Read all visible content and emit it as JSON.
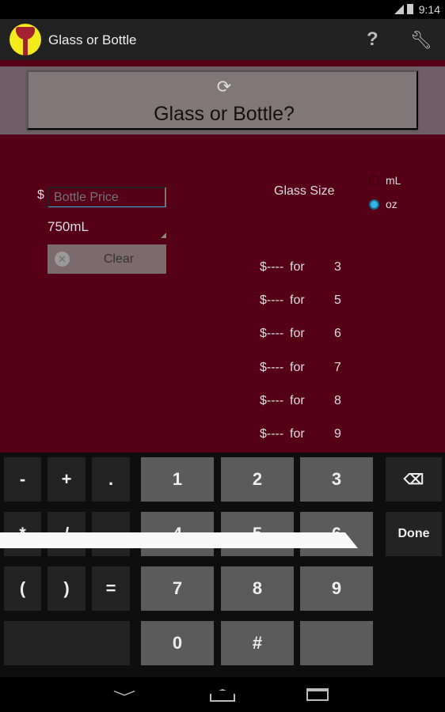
{
  "status": {
    "time": "9:14"
  },
  "actionbar": {
    "title": "Glass or Bottle",
    "help_icon": "?",
    "settings_icon": "wrench-icon"
  },
  "main_button": {
    "title": "Glass or Bottle?",
    "icon": "refresh-icon"
  },
  "form": {
    "currency": "$",
    "price_placeholder": "Bottle Price",
    "price_value": "",
    "bottle_size": "750mL",
    "clear_label": "Clear",
    "glass_size_label": "Glass Size",
    "units": [
      {
        "label": "mL",
        "selected": false
      },
      {
        "label": "oz",
        "selected": true
      }
    ]
  },
  "results": [
    {
      "price": "$----",
      "for": "for",
      "size": "3"
    },
    {
      "price": "$----",
      "for": "for",
      "size": "5"
    },
    {
      "price": "$----",
      "for": "for",
      "size": "6"
    },
    {
      "price": "$----",
      "for": "for",
      "size": "7"
    },
    {
      "price": "$----",
      "for": "for",
      "size": "8"
    },
    {
      "price": "$----",
      "for": "for",
      "size": "9"
    }
  ],
  "keyboard": {
    "keys": [
      "-",
      "+",
      ".",
      "1",
      "2",
      "3",
      "⌫",
      "*",
      "/",
      "",
      "4",
      "5",
      "6",
      "Done",
      "(",
      ")",
      "=",
      "7",
      "8",
      "9",
      "",
      "*",
      "0",
      "#"
    ]
  },
  "colors": {
    "background": "#560018",
    "accent": "#33b5e5"
  }
}
